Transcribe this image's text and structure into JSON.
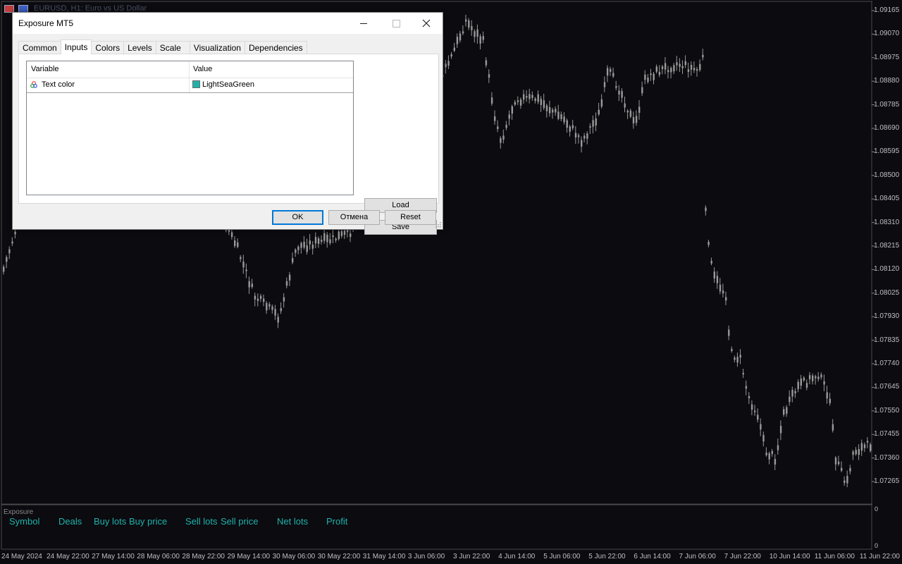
{
  "chart": {
    "title": "EURUSD, H1:  Euro vs US Dollar",
    "price_axis": [
      "1.09165",
      "1.09070",
      "1.08975",
      "1.08880",
      "1.08785",
      "1.08690",
      "1.08595",
      "1.08500",
      "1.08405",
      "1.08310",
      "1.08215",
      "1.08120",
      "1.08025",
      "1.07930",
      "1.07835",
      "1.07740",
      "1.07645",
      "1.07550",
      "1.07455",
      "1.07360",
      "1.07265"
    ],
    "date_axis": [
      "24 May 2024",
      "24 May 22:00",
      "27 May 14:00",
      "28 May 06:00",
      "28 May 22:00",
      "29 May 14:00",
      "30 May 06:00",
      "30 May 22:00",
      "31 May 14:00",
      "3 Jun 06:00",
      "3 Jun 22:00",
      "4 Jun 14:00",
      "5 Jun 06:00",
      "5 Jun 22:00",
      "6 Jun 14:00",
      "7 Jun 06:00",
      "7 Jun 22:00",
      "10 Jun 14:00",
      "11 Jun 06:00",
      "11 Jun 22:00"
    ],
    "candle_color": "#9a9a9a",
    "background": "#0b0b10"
  },
  "indicator": {
    "title": "Exposure",
    "columns": [
      "Symbol",
      "Deals",
      "Buy lots",
      "Buy price",
      "Sell lots",
      "Sell price",
      "Net lots",
      "Profit"
    ],
    "scale_top": "0",
    "scale_bottom": "0",
    "text_color": "#20b2aa"
  },
  "dialog": {
    "title": "Exposure MT5",
    "tabs": [
      "Common",
      "Inputs",
      "Colors",
      "Levels",
      "Scale",
      "Visualization",
      "Dependencies"
    ],
    "active_tab": "Inputs",
    "table": {
      "headers": {
        "variable": "Variable",
        "value": "Value"
      },
      "rows": [
        {
          "variable": "Text color",
          "value": "LightSeaGreen",
          "swatch": "#20b2aa"
        }
      ]
    },
    "buttons": {
      "load": "Load",
      "save": "Save",
      "ok": "OK",
      "cancel": "Отмена",
      "reset": "Reset"
    }
  }
}
